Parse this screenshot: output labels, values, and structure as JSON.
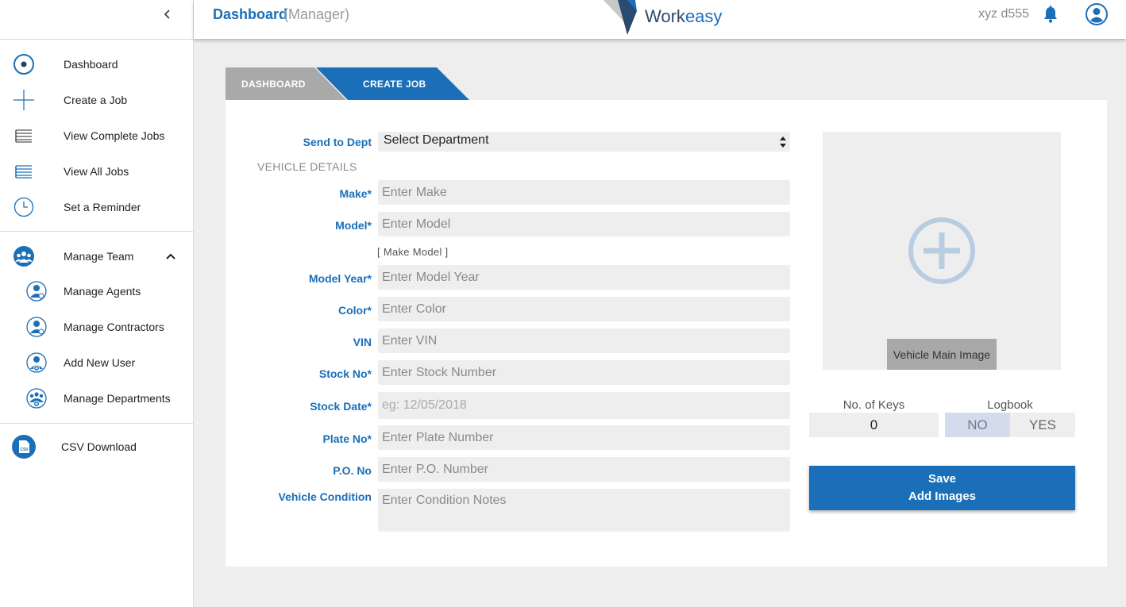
{
  "header": {
    "title": "Dashboard",
    "role": "(Manager)",
    "logo_text_a": "Work",
    "logo_text_b": "easy",
    "user_name": "xyz d555"
  },
  "sidebar": {
    "items": [
      {
        "label": "Dashboard",
        "icon": "target-icon"
      },
      {
        "label": "Create a Job",
        "icon": "plus-icon"
      },
      {
        "label": "View Complete Jobs",
        "icon": "list-icon"
      },
      {
        "label": "View All Jobs",
        "icon": "list-blue-icon"
      },
      {
        "label": "Set a Reminder",
        "icon": "clock-icon"
      }
    ],
    "team": {
      "label": "Manage Team",
      "children": [
        {
          "label": "Manage Agents"
        },
        {
          "label": "Manage Contractors"
        },
        {
          "label": "Add New User"
        },
        {
          "label": "Manage Departments"
        }
      ]
    },
    "csv": {
      "label": "CSV Download",
      "icon_text": "CSV"
    }
  },
  "breadcrumb": {
    "items": [
      "DASHBOARD",
      "CREATE JOB"
    ]
  },
  "form": {
    "send_to_dept": {
      "label": "Send to Dept",
      "value": "Select Department"
    },
    "section_title": "VEHICLE DETAILS",
    "make": {
      "label": "Make*",
      "placeholder": "Enter Make"
    },
    "model": {
      "label": "Model*",
      "placeholder": "Enter Model"
    },
    "make_model_link": "[ Make Model ]",
    "model_year": {
      "label": "Model Year*",
      "placeholder": "Enter Model Year"
    },
    "color": {
      "label": "Color*",
      "placeholder": "Enter Color"
    },
    "vin": {
      "label": "VIN",
      "placeholder": "Enter VIN"
    },
    "stock_no": {
      "label": "Stock No*",
      "placeholder": "Enter Stock Number"
    },
    "stock_date": {
      "label": "Stock Date*",
      "placeholder": "eg: 12/05/2018"
    },
    "plate_no": {
      "label": "Plate No*",
      "placeholder": "Enter Plate Number"
    },
    "po_no": {
      "label": "P.O. No",
      "placeholder": "Enter P.O. Number"
    },
    "condition": {
      "label": "Vehicle Condition",
      "placeholder": "Enter Condition Notes"
    }
  },
  "image_panel": {
    "caption": "Vehicle Main Image"
  },
  "keys": {
    "label": "No. of Keys",
    "value": "0"
  },
  "logbook": {
    "label": "Logbook",
    "no": "NO",
    "yes": "YES",
    "selected": "NO"
  },
  "save": {
    "line1": "Save",
    "line2": "Add Images"
  },
  "colors": {
    "accent": "#1a6fb8",
    "crumb_inactive": "#a9a9a9",
    "panel": "#eeeeee"
  }
}
